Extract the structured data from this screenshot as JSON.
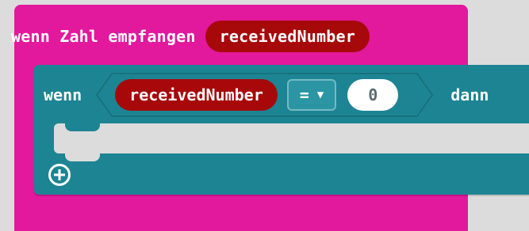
{
  "event_block": {
    "label": "wenn Zahl empfangen",
    "variable": "receivedNumber",
    "color": "#e2189d",
    "variable_color": "#a7090b"
  },
  "if_block": {
    "keyword": "wenn",
    "variable": "receivedNumber",
    "operator": "=",
    "value": "0",
    "then_keyword": "dann",
    "color": "#1d8493"
  },
  "icons": {
    "operator_dropdown": "caret-down-icon",
    "add": "plus-circle-icon"
  }
}
